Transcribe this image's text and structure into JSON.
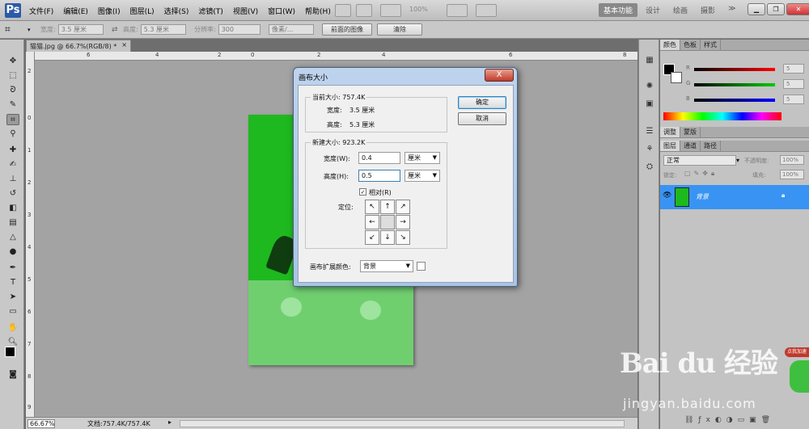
{
  "app": {
    "logo": "Ps",
    "menus": [
      "文件(F)",
      "编辑(E)",
      "图像(I)",
      "图层(L)",
      "选择(S)",
      "滤镜(T)",
      "视图(V)",
      "窗口(W)",
      "帮助(H)"
    ],
    "zoom_display": "100%",
    "workspaces": [
      "基本功能",
      "设计",
      "绘画",
      "摄影"
    ],
    "active_workspace": "基本功能",
    "more_workspaces": "≫"
  },
  "options_bar": {
    "width_label": "宽度:",
    "width_value": "3.5 厘米",
    "height_label": "高度:",
    "height_value": "5.3 厘米",
    "resolution_label": "分辨率:",
    "resolution_value": "300",
    "unit_value": "像素/...",
    "front_image_btn": "前面的图像",
    "clear_btn": "清除"
  },
  "document": {
    "tab_title": "猫猫.jpg @ 66.7%(RGB/8) *",
    "zoom": "66.67%",
    "doc_info": "文档:757.4K/757.4K",
    "ruler_h": [
      "6",
      "4",
      "2",
      "0",
      "2",
      "4",
      "6",
      "8"
    ],
    "ruler_v": [
      "2",
      "0",
      "1",
      "2",
      "3",
      "4",
      "5",
      "6",
      "7",
      "8",
      "9"
    ]
  },
  "color_panel": {
    "tabs": [
      "颜色",
      "色板",
      "样式"
    ],
    "r_label": "R",
    "g_label": "G",
    "b_label": "B",
    "r_value": "5",
    "g_value": "5",
    "b_value": "5"
  },
  "adjust_panel": {
    "tabs": [
      "调整",
      "蒙版"
    ]
  },
  "layers_panel": {
    "tabs": [
      "图层",
      "通道",
      "路径"
    ],
    "blend_mode": "正常",
    "opacity_label": "不透明度:",
    "opacity_value": "100%",
    "lock_label": "锁定:",
    "fill_label": "填充:",
    "fill_value": "100%",
    "layer_name": "背景"
  },
  "dialog": {
    "title": "画布大小",
    "close": "X",
    "current_size_label": "当前大小: 757.4K",
    "current_width_label": "宽度:",
    "current_width_value": "3.5 厘米",
    "current_height_label": "高度:",
    "current_height_value": "5.3 厘米",
    "new_size_label": "新建大小: 923.2K",
    "width_label": "宽度(W):",
    "width_value": "0.4",
    "width_unit": "厘米",
    "height_label": "高度(H):",
    "height_value": "0.5",
    "height_unit": "厘米",
    "relative_label": "相对(R)",
    "relative_checked": true,
    "anchor_label": "定位:",
    "canvas_ext_label": "画布扩展颜色:",
    "canvas_ext_value": "背景",
    "ok": "确定",
    "cancel": "取消"
  },
  "watermark": {
    "logo": "Bai du 经验",
    "url": "jingyan.baidu.com",
    "badge_text": "点我加速"
  }
}
